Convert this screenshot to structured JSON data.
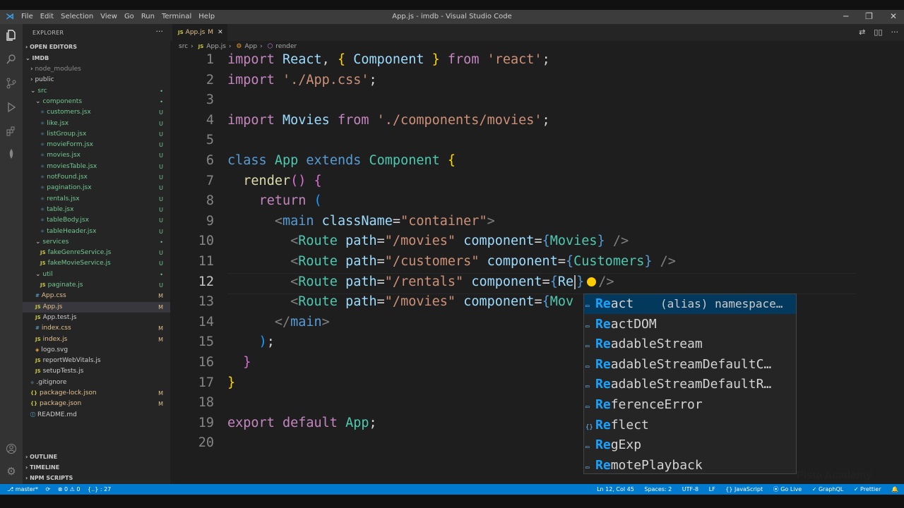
{
  "window": {
    "title": "App.js - imdb - Visual Studio Code"
  },
  "menu": [
    "File",
    "Edit",
    "Selection",
    "View",
    "Go",
    "Run",
    "Terminal",
    "Help"
  ],
  "explorer": {
    "header": "EXPLORER",
    "open_editors": "OPEN EDITORS",
    "project": "IMDB",
    "outline": "OUTLINE",
    "timeline": "TIMELINE",
    "npm_scripts": "NPM SCRIPTS",
    "tree": [
      {
        "name": "node_modules",
        "type": "folder",
        "indent": 1,
        "status": "",
        "color": "grey"
      },
      {
        "name": "public",
        "type": "folder",
        "indent": 1,
        "status": "",
        "color": "normal"
      },
      {
        "name": "src",
        "type": "folder-open",
        "indent": 1,
        "status": "•",
        "color": "green"
      },
      {
        "name": "components",
        "type": "folder-open",
        "indent": 2,
        "status": "•",
        "color": "green"
      },
      {
        "name": "customers.jsx",
        "type": "jsx",
        "indent": 3,
        "status": "U",
        "color": "green"
      },
      {
        "name": "like.jsx",
        "type": "jsx",
        "indent": 3,
        "status": "U",
        "color": "green"
      },
      {
        "name": "listGroup.jsx",
        "type": "jsx",
        "indent": 3,
        "status": "U",
        "color": "green"
      },
      {
        "name": "movieForm.jsx",
        "type": "jsx",
        "indent": 3,
        "status": "U",
        "color": "green"
      },
      {
        "name": "movies.jsx",
        "type": "jsx",
        "indent": 3,
        "status": "U",
        "color": "green"
      },
      {
        "name": "moviesTable.jsx",
        "type": "jsx",
        "indent": 3,
        "status": "U",
        "color": "green"
      },
      {
        "name": "notFound.jsx",
        "type": "jsx",
        "indent": 3,
        "status": "U",
        "color": "green"
      },
      {
        "name": "pagination.jsx",
        "type": "jsx",
        "indent": 3,
        "status": "U",
        "color": "green"
      },
      {
        "name": "rentals.jsx",
        "type": "jsx",
        "indent": 3,
        "status": "U",
        "color": "green"
      },
      {
        "name": "table.jsx",
        "type": "jsx",
        "indent": 3,
        "status": "U",
        "color": "green"
      },
      {
        "name": "tableBody.jsx",
        "type": "jsx",
        "indent": 3,
        "status": "U",
        "color": "green"
      },
      {
        "name": "tableHeader.jsx",
        "type": "jsx",
        "indent": 3,
        "status": "U",
        "color": "green"
      },
      {
        "name": "services",
        "type": "folder-open",
        "indent": 2,
        "status": "•",
        "color": "green"
      },
      {
        "name": "fakeGenreService.js",
        "type": "js",
        "indent": 3,
        "status": "U",
        "color": "green"
      },
      {
        "name": "fakeMovieService.js",
        "type": "js",
        "indent": 3,
        "status": "U",
        "color": "green"
      },
      {
        "name": "util",
        "type": "folder-open",
        "indent": 2,
        "status": "•",
        "color": "green"
      },
      {
        "name": "paginate.js",
        "type": "js",
        "indent": 3,
        "status": "U",
        "color": "green"
      },
      {
        "name": "App.css",
        "type": "css",
        "indent": 2,
        "status": "M",
        "color": "yellow"
      },
      {
        "name": "App.js",
        "type": "js",
        "indent": 2,
        "status": "M",
        "color": "yellow",
        "active": true
      },
      {
        "name": "App.test.js",
        "type": "js",
        "indent": 2,
        "status": "",
        "color": "normal"
      },
      {
        "name": "index.css",
        "type": "css",
        "indent": 2,
        "status": "M",
        "color": "yellow"
      },
      {
        "name": "index.js",
        "type": "js",
        "indent": 2,
        "status": "M",
        "color": "yellow"
      },
      {
        "name": "logo.svg",
        "type": "svg",
        "indent": 2,
        "status": "",
        "color": "normal"
      },
      {
        "name": "reportWebVitals.js",
        "type": "js",
        "indent": 2,
        "status": "",
        "color": "normal"
      },
      {
        "name": "setupTests.js",
        "type": "js",
        "indent": 2,
        "status": "",
        "color": "normal"
      },
      {
        "name": ".gitignore",
        "type": "git",
        "indent": 1,
        "status": "",
        "color": "normal"
      },
      {
        "name": "package-lock.json",
        "type": "json",
        "indent": 1,
        "status": "M",
        "color": "yellow"
      },
      {
        "name": "package.json",
        "type": "json",
        "indent": 1,
        "status": "M",
        "color": "yellow"
      },
      {
        "name": "README.md",
        "type": "md",
        "indent": 1,
        "status": "",
        "color": "normal"
      }
    ]
  },
  "tab": {
    "label": "App.js",
    "status": "M",
    "close": "✕",
    "badge": "JS"
  },
  "breadcrumbs": [
    "src",
    "App.js",
    "App",
    "render"
  ],
  "code": {
    "line_numbers": [
      "1",
      "2",
      "3",
      "4",
      "5",
      "6",
      "7",
      "8",
      "9",
      "10",
      "11",
      "12",
      "13",
      "14",
      "15",
      "16",
      "17",
      "18",
      "19",
      "20"
    ],
    "lines": [
      [
        [
          "kw",
          "import"
        ],
        [
          "pl",
          " "
        ],
        [
          "id",
          "React"
        ],
        [
          "pl",
          ", "
        ],
        [
          "br",
          "{"
        ],
        [
          "pl",
          " "
        ],
        [
          "id",
          "Component"
        ],
        [
          "pl",
          " "
        ],
        [
          "br",
          "}"
        ],
        [
          "pl",
          " "
        ],
        [
          "kw",
          "from"
        ],
        [
          "pl",
          " "
        ],
        [
          "str",
          "'react'"
        ],
        [
          "pl",
          ";"
        ]
      ],
      [
        [
          "kw",
          "import"
        ],
        [
          "pl",
          " "
        ],
        [
          "str",
          "'./App.css'"
        ],
        [
          "pl",
          ";"
        ]
      ],
      [],
      [
        [
          "kw",
          "import"
        ],
        [
          "pl",
          " "
        ],
        [
          "id",
          "Movies"
        ],
        [
          "pl",
          " "
        ],
        [
          "kw",
          "from"
        ],
        [
          "pl",
          " "
        ],
        [
          "str",
          "'./components/movies'"
        ],
        [
          "pl",
          ";"
        ]
      ],
      [],
      [
        [
          "bl",
          "class"
        ],
        [
          "pl",
          " "
        ],
        [
          "cls",
          "App"
        ],
        [
          "pl",
          " "
        ],
        [
          "bl",
          "extends"
        ],
        [
          "pl",
          " "
        ],
        [
          "cls",
          "Component"
        ],
        [
          "pl",
          " "
        ],
        [
          "br",
          "{"
        ]
      ],
      [
        [
          "pl",
          "  "
        ],
        [
          "fn",
          "render"
        ],
        [
          "br2",
          "()"
        ],
        [
          "pl",
          " "
        ],
        [
          "br2",
          "{"
        ]
      ],
      [
        [
          "pl",
          "    "
        ],
        [
          "kw",
          "return"
        ],
        [
          "pl",
          " "
        ],
        [
          "br3",
          "("
        ]
      ],
      [
        [
          "pl",
          "      "
        ],
        [
          "tag",
          "<"
        ],
        [
          "bl",
          "main"
        ],
        [
          "pl",
          " "
        ],
        [
          "attr",
          "className"
        ],
        [
          "pl",
          "="
        ],
        [
          "str",
          "\"container\""
        ],
        [
          "tag",
          ">"
        ]
      ],
      [
        [
          "pl",
          "        "
        ],
        [
          "tag",
          "<"
        ],
        [
          "cls",
          "Route"
        ],
        [
          "pl",
          " "
        ],
        [
          "attr",
          "path"
        ],
        [
          "pl",
          "="
        ],
        [
          "str",
          "\"/movies\""
        ],
        [
          "pl",
          " "
        ],
        [
          "attr",
          "component"
        ],
        [
          "pl",
          "="
        ],
        [
          "bl",
          "{"
        ],
        [
          "cls",
          "Movies"
        ],
        [
          "bl",
          "}"
        ],
        [
          "pl",
          " "
        ],
        [
          "tag",
          "/>"
        ]
      ],
      [
        [
          "pl",
          "        "
        ],
        [
          "tag",
          "<"
        ],
        [
          "cls",
          "Route"
        ],
        [
          "pl",
          " "
        ],
        [
          "attr",
          "path"
        ],
        [
          "pl",
          "="
        ],
        [
          "str",
          "\"/customers\""
        ],
        [
          "pl",
          " "
        ],
        [
          "attr",
          "component"
        ],
        [
          "pl",
          "="
        ],
        [
          "bl",
          "{"
        ],
        [
          "cls",
          "Customers"
        ],
        [
          "bl",
          "}"
        ],
        [
          "pl",
          " "
        ],
        [
          "tag",
          "/>"
        ]
      ],
      [
        [
          "pl",
          "        "
        ],
        [
          "tag",
          "<"
        ],
        [
          "cls",
          "Route"
        ],
        [
          "pl",
          " "
        ],
        [
          "attr",
          "path"
        ],
        [
          "pl",
          "="
        ],
        [
          "str",
          "\"/rentals\""
        ],
        [
          "pl",
          " "
        ],
        [
          "attr",
          "component"
        ],
        [
          "pl",
          "="
        ],
        [
          "bl",
          "{"
        ],
        [
          "id",
          "Re"
        ],
        [
          "caret",
          ""
        ],
        [
          "bl",
          "}"
        ],
        [
          "bulb",
          ""
        ],
        [
          "tag",
          "/>"
        ]
      ],
      [
        [
          "pl",
          "        "
        ],
        [
          "tag",
          "<"
        ],
        [
          "cls",
          "Route"
        ],
        [
          "pl",
          " "
        ],
        [
          "attr",
          "path"
        ],
        [
          "pl",
          "="
        ],
        [
          "str",
          "\"/movies\""
        ],
        [
          "pl",
          " "
        ],
        [
          "attr",
          "component"
        ],
        [
          "pl",
          "="
        ],
        [
          "bl",
          "{"
        ],
        [
          "cls",
          "Mov"
        ]
      ],
      [
        [
          "pl",
          "      "
        ],
        [
          "tag",
          "</"
        ],
        [
          "bl",
          "main"
        ],
        [
          "tag",
          ">"
        ]
      ],
      [
        [
          "pl",
          "    "
        ],
        [
          "br3",
          ")"
        ],
        [
          "pl",
          ";"
        ]
      ],
      [
        [
          "pl",
          "  "
        ],
        [
          "br2",
          "}"
        ]
      ],
      [
        [
          "br",
          "}"
        ]
      ],
      [],
      [
        [
          "kw",
          "export"
        ],
        [
          "pl",
          " "
        ],
        [
          "kw",
          "default"
        ],
        [
          "pl",
          " "
        ],
        [
          "cls",
          "App"
        ],
        [
          "pl",
          ";"
        ]
      ],
      []
    ]
  },
  "suggestions": [
    {
      "match": "Re",
      "rest": "act",
      "detail": "(alias) namespace…",
      "icon": "▭",
      "selected": true
    },
    {
      "match": "Re",
      "rest": "actDOM",
      "icon": "▭"
    },
    {
      "match": "Re",
      "rest": "adableStream",
      "icon": "▭"
    },
    {
      "match": "Re",
      "rest": "adableStreamDefaultC…",
      "icon": "▭"
    },
    {
      "match": "Re",
      "rest": "adableStreamDefaultR…",
      "icon": "▭"
    },
    {
      "match": "Re",
      "rest": "ferenceError",
      "icon": "▭"
    },
    {
      "match": "Re",
      "rest": "flect",
      "icon": "{}"
    },
    {
      "match": "Re",
      "rest": "gExp",
      "icon": "▭"
    },
    {
      "match": "Re",
      "rest": "motePlayback",
      "icon": "▭"
    }
  ],
  "status": {
    "branch": "master*",
    "sync": "⟳",
    "problems": "⊗ 0 ⚠ 0",
    "extra": "{..} : 27",
    "position": "Ln 12, Col 45",
    "spaces": "Spaces: 2",
    "encoding": "UTF-8",
    "eol": "LF",
    "language": "{} JavaScript",
    "golive": "⦿ Go Live",
    "graphql": "✓ GraphQL",
    "prettier": "✓ Prettier"
  },
  "watermark": "Pista Academy",
  "colors": {
    "accent": "#007acc",
    "sidebar": "#252526",
    "editor": "#1e1e1e",
    "modified": "#e2c08d",
    "untracked": "#73c991"
  }
}
